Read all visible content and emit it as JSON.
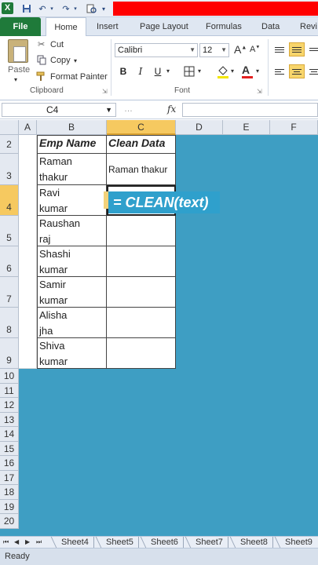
{
  "app": {
    "logo": "X"
  },
  "quick_access": {
    "save_icon": "save-icon",
    "undo_icon": "undo-icon",
    "redo_icon": "redo-icon"
  },
  "tabs": [
    "File",
    "Home",
    "Insert",
    "Page Layout",
    "Formulas",
    "Data",
    "Revi"
  ],
  "clipboard": {
    "paste": "Paste",
    "cut": "Cut",
    "copy": "Copy",
    "format_painter": "Format Painter",
    "group_label": "Clipboard"
  },
  "font": {
    "name": "Calibri",
    "size": "12",
    "bold": "B",
    "italic": "I",
    "underline": "U",
    "group_label": "Font",
    "grow": "A",
    "shrink": "A"
  },
  "formula_bar": {
    "name_box": "C4",
    "fx": "fx",
    "formula": ""
  },
  "columns": [
    "A",
    "B",
    "C",
    "D",
    "E",
    "F"
  ],
  "selected_column": "C",
  "rows_visible": [
    "2",
    "3",
    "4",
    "5",
    "6",
    "7",
    "8",
    "9",
    "10",
    "11",
    "12",
    "13",
    "14",
    "15",
    "16",
    "17",
    "18",
    "19",
    "20"
  ],
  "selected_row": "4",
  "table": {
    "headers": [
      "Emp Name",
      "Clean Data"
    ],
    "rows": [
      {
        "name_line1": "Raman",
        "name_line2": "thakur",
        "clean": "Raman thakur"
      },
      {
        "name_line1": "Ravi",
        "name_line2": "kumar",
        "clean": ""
      },
      {
        "name_line1": "Raushan",
        "name_line2": "raj",
        "clean": ""
      },
      {
        "name_line1": "Shashi",
        "name_line2": "kumar",
        "clean": ""
      },
      {
        "name_line1": "Samir",
        "name_line2": "kumar",
        "clean": ""
      },
      {
        "name_line1": "Alisha",
        "name_line2": "jha",
        "clean": ""
      },
      {
        "name_line1": "Shiva",
        "name_line2": "kumar",
        "clean": ""
      }
    ]
  },
  "formula_tip": "= CLEAN(text)",
  "sheets": [
    "Sheet4",
    "Sheet5",
    "Sheet6",
    "Sheet7",
    "Sheet8",
    "Sheet9"
  ],
  "status": "Ready",
  "colors": {
    "accent_green": "#1f7a3a",
    "selection_orange": "#f6c960",
    "overlay_blue": "#3e9ec3",
    "red_bar": "#ff0000"
  }
}
